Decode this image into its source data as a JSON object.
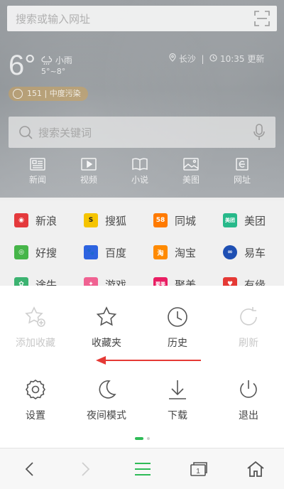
{
  "search_bar": {
    "placeholder": "搜索或输入网址"
  },
  "weather": {
    "temperature": "6°",
    "condition": "小雨",
    "range": "5°~8°",
    "location": "长沙",
    "time": "10:35 更新",
    "air_quality": "151 | 中度污染"
  },
  "keyword_search": {
    "placeholder": "搜索关键词"
  },
  "categories": [
    {
      "label": "新闻",
      "icon": "news-icon"
    },
    {
      "label": "视频",
      "icon": "video-icon"
    },
    {
      "label": "小说",
      "icon": "book-icon"
    },
    {
      "label": "美图",
      "icon": "image-icon"
    },
    {
      "label": "网址",
      "icon": "web-icon"
    }
  ],
  "shortcuts": [
    {
      "label": "新浪",
      "color": "#e4393c",
      "icon": "sina-logo"
    },
    {
      "label": "搜狐",
      "color": "#f5c400",
      "icon": "sohu-logo"
    },
    {
      "label": "同城",
      "color": "#ff7a00",
      "icon": "58-logo",
      "badge": "58"
    },
    {
      "label": "美团",
      "color": "#27b98a",
      "icon": "meituan-logo",
      "badge": "美团"
    },
    {
      "label": "好搜",
      "color": "#46b549",
      "icon": "haosou-logo"
    },
    {
      "label": "百度",
      "color": "#2d63e0",
      "icon": "baidu-logo"
    },
    {
      "label": "淘宝",
      "color": "#ff8a00",
      "icon": "taobao-logo",
      "badge": "淘"
    },
    {
      "label": "易车",
      "color": "#1e4fb3",
      "icon": "yiche-logo"
    },
    {
      "label": "途牛",
      "color": "#3cb371",
      "icon": "tuniu-logo"
    },
    {
      "label": "游戏",
      "color": "#f06292",
      "icon": "game-logo"
    },
    {
      "label": "聚美",
      "color": "#e91e63",
      "icon": "jumei-logo",
      "badge": "聚美"
    },
    {
      "label": "有缘",
      "color": "#e53935",
      "icon": "youyuan-logo"
    }
  ],
  "menu": [
    {
      "label": "添加收藏",
      "icon": "add-bookmark-icon",
      "enabled": false
    },
    {
      "label": "收藏夹",
      "icon": "star-icon",
      "enabled": true
    },
    {
      "label": "历史",
      "icon": "clock-icon",
      "enabled": true
    },
    {
      "label": "刷新",
      "icon": "refresh-icon",
      "enabled": false
    },
    {
      "label": "设置",
      "icon": "gear-icon",
      "enabled": true
    },
    {
      "label": "夜间模式",
      "icon": "moon-icon",
      "enabled": true
    },
    {
      "label": "下载",
      "icon": "download-icon",
      "enabled": true
    },
    {
      "label": "退出",
      "icon": "power-icon",
      "enabled": true
    }
  ],
  "colors": {
    "accent": "#2fbb57",
    "annotation_arrow": "#e53935"
  },
  "toolbar": {
    "tabs_count": "1"
  }
}
